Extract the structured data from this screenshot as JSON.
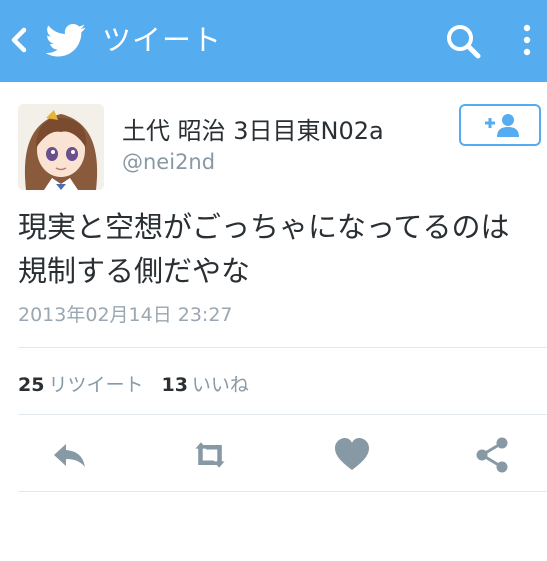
{
  "header": {
    "title": "ツイート",
    "color": "#55acee",
    "icons": [
      "chevron-left-icon",
      "twitter-bird-icon",
      "search-icon",
      "more-vertical-icon"
    ]
  },
  "tweet": {
    "display_name": "土代 昭治 3日目東N02a",
    "handle": "@nei2nd",
    "text": "現実と空想がごっちゃになってるのは規制する側だやな",
    "timestamp": "2013年02月14日 23:27"
  },
  "stats": {
    "retweet_count": "25",
    "retweet_label": "リツイート",
    "like_count": "13",
    "like_label": "いいね"
  },
  "actions": [
    "reply-icon",
    "retweet-icon",
    "heart-icon",
    "share-icon"
  ],
  "colors": {
    "accent": "#55acee",
    "icon_gray": "#8899a6",
    "text": "#292f33"
  }
}
